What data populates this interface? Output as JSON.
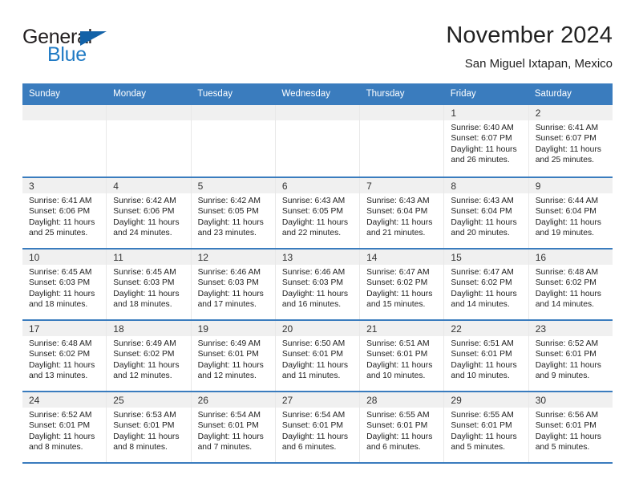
{
  "brand": {
    "word1": "General",
    "word2": "Blue",
    "logo_icon": "triangle-logo-icon",
    "accent_color": "#1262a8"
  },
  "header": {
    "title": "November 2024",
    "subtitle": "San Miguel Ixtapan, Mexico"
  },
  "calendar": {
    "header_bg": "#3a7cbe",
    "weekdays": [
      "Sunday",
      "Monday",
      "Tuesday",
      "Wednesday",
      "Thursday",
      "Friday",
      "Saturday"
    ],
    "weeks": [
      [
        {
          "day": "",
          "empty": true
        },
        {
          "day": "",
          "empty": true
        },
        {
          "day": "",
          "empty": true
        },
        {
          "day": "",
          "empty": true
        },
        {
          "day": "",
          "empty": true
        },
        {
          "day": "1",
          "sunrise": "Sunrise: 6:40 AM",
          "sunset": "Sunset: 6:07 PM",
          "daylight": "Daylight: 11 hours and 26 minutes."
        },
        {
          "day": "2",
          "sunrise": "Sunrise: 6:41 AM",
          "sunset": "Sunset: 6:07 PM",
          "daylight": "Daylight: 11 hours and 25 minutes."
        }
      ],
      [
        {
          "day": "3",
          "sunrise": "Sunrise: 6:41 AM",
          "sunset": "Sunset: 6:06 PM",
          "daylight": "Daylight: 11 hours and 25 minutes."
        },
        {
          "day": "4",
          "sunrise": "Sunrise: 6:42 AM",
          "sunset": "Sunset: 6:06 PM",
          "daylight": "Daylight: 11 hours and 24 minutes."
        },
        {
          "day": "5",
          "sunrise": "Sunrise: 6:42 AM",
          "sunset": "Sunset: 6:05 PM",
          "daylight": "Daylight: 11 hours and 23 minutes."
        },
        {
          "day": "6",
          "sunrise": "Sunrise: 6:43 AM",
          "sunset": "Sunset: 6:05 PM",
          "daylight": "Daylight: 11 hours and 22 minutes."
        },
        {
          "day": "7",
          "sunrise": "Sunrise: 6:43 AM",
          "sunset": "Sunset: 6:04 PM",
          "daylight": "Daylight: 11 hours and 21 minutes."
        },
        {
          "day": "8",
          "sunrise": "Sunrise: 6:43 AM",
          "sunset": "Sunset: 6:04 PM",
          "daylight": "Daylight: 11 hours and 20 minutes."
        },
        {
          "day": "9",
          "sunrise": "Sunrise: 6:44 AM",
          "sunset": "Sunset: 6:04 PM",
          "daylight": "Daylight: 11 hours and 19 minutes."
        }
      ],
      [
        {
          "day": "10",
          "sunrise": "Sunrise: 6:45 AM",
          "sunset": "Sunset: 6:03 PM",
          "daylight": "Daylight: 11 hours and 18 minutes."
        },
        {
          "day": "11",
          "sunrise": "Sunrise: 6:45 AM",
          "sunset": "Sunset: 6:03 PM",
          "daylight": "Daylight: 11 hours and 18 minutes."
        },
        {
          "day": "12",
          "sunrise": "Sunrise: 6:46 AM",
          "sunset": "Sunset: 6:03 PM",
          "daylight": "Daylight: 11 hours and 17 minutes."
        },
        {
          "day": "13",
          "sunrise": "Sunrise: 6:46 AM",
          "sunset": "Sunset: 6:03 PM",
          "daylight": "Daylight: 11 hours and 16 minutes."
        },
        {
          "day": "14",
          "sunrise": "Sunrise: 6:47 AM",
          "sunset": "Sunset: 6:02 PM",
          "daylight": "Daylight: 11 hours and 15 minutes."
        },
        {
          "day": "15",
          "sunrise": "Sunrise: 6:47 AM",
          "sunset": "Sunset: 6:02 PM",
          "daylight": "Daylight: 11 hours and 14 minutes."
        },
        {
          "day": "16",
          "sunrise": "Sunrise: 6:48 AM",
          "sunset": "Sunset: 6:02 PM",
          "daylight": "Daylight: 11 hours and 14 minutes."
        }
      ],
      [
        {
          "day": "17",
          "sunrise": "Sunrise: 6:48 AM",
          "sunset": "Sunset: 6:02 PM",
          "daylight": "Daylight: 11 hours and 13 minutes."
        },
        {
          "day": "18",
          "sunrise": "Sunrise: 6:49 AM",
          "sunset": "Sunset: 6:02 PM",
          "daylight": "Daylight: 11 hours and 12 minutes."
        },
        {
          "day": "19",
          "sunrise": "Sunrise: 6:49 AM",
          "sunset": "Sunset: 6:01 PM",
          "daylight": "Daylight: 11 hours and 12 minutes."
        },
        {
          "day": "20",
          "sunrise": "Sunrise: 6:50 AM",
          "sunset": "Sunset: 6:01 PM",
          "daylight": "Daylight: 11 hours and 11 minutes."
        },
        {
          "day": "21",
          "sunrise": "Sunrise: 6:51 AM",
          "sunset": "Sunset: 6:01 PM",
          "daylight": "Daylight: 11 hours and 10 minutes."
        },
        {
          "day": "22",
          "sunrise": "Sunrise: 6:51 AM",
          "sunset": "Sunset: 6:01 PM",
          "daylight": "Daylight: 11 hours and 10 minutes."
        },
        {
          "day": "23",
          "sunrise": "Sunrise: 6:52 AM",
          "sunset": "Sunset: 6:01 PM",
          "daylight": "Daylight: 11 hours and 9 minutes."
        }
      ],
      [
        {
          "day": "24",
          "sunrise": "Sunrise: 6:52 AM",
          "sunset": "Sunset: 6:01 PM",
          "daylight": "Daylight: 11 hours and 8 minutes."
        },
        {
          "day": "25",
          "sunrise": "Sunrise: 6:53 AM",
          "sunset": "Sunset: 6:01 PM",
          "daylight": "Daylight: 11 hours and 8 minutes."
        },
        {
          "day": "26",
          "sunrise": "Sunrise: 6:54 AM",
          "sunset": "Sunset: 6:01 PM",
          "daylight": "Daylight: 11 hours and 7 minutes."
        },
        {
          "day": "27",
          "sunrise": "Sunrise: 6:54 AM",
          "sunset": "Sunset: 6:01 PM",
          "daylight": "Daylight: 11 hours and 6 minutes."
        },
        {
          "day": "28",
          "sunrise": "Sunrise: 6:55 AM",
          "sunset": "Sunset: 6:01 PM",
          "daylight": "Daylight: 11 hours and 6 minutes."
        },
        {
          "day": "29",
          "sunrise": "Sunrise: 6:55 AM",
          "sunset": "Sunset: 6:01 PM",
          "daylight": "Daylight: 11 hours and 5 minutes."
        },
        {
          "day": "30",
          "sunrise": "Sunrise: 6:56 AM",
          "sunset": "Sunset: 6:01 PM",
          "daylight": "Daylight: 11 hours and 5 minutes."
        }
      ]
    ]
  }
}
